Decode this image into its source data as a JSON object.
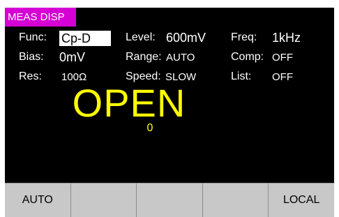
{
  "title": "MEAS DISP",
  "params": {
    "func_label": "Func:",
    "func_value": "Cp-D",
    "level_label": "Level:",
    "level_value": "600mV",
    "freq_label": "Freq:",
    "freq_value": "1kHz",
    "bias_label": "Bias:",
    "bias_value": "0mV",
    "range_label": "Range:",
    "range_value": "AUTO",
    "comp_label": "Comp:",
    "comp_value": "OFF",
    "res_label": "Res:",
    "res_value": "100Ω",
    "speed_label": "Speed:",
    "speed_value": "SLOW",
    "list_label": "List:",
    "list_value": "OFF"
  },
  "measurement": {
    "primary": "OPEN",
    "secondary": "0"
  },
  "softkeys": [
    "AUTO",
    "",
    "",
    "",
    "LOCAL"
  ],
  "colors": {
    "title_bg": "#d400d4",
    "measure": "#ffff00",
    "screen_bg": "#000000"
  }
}
